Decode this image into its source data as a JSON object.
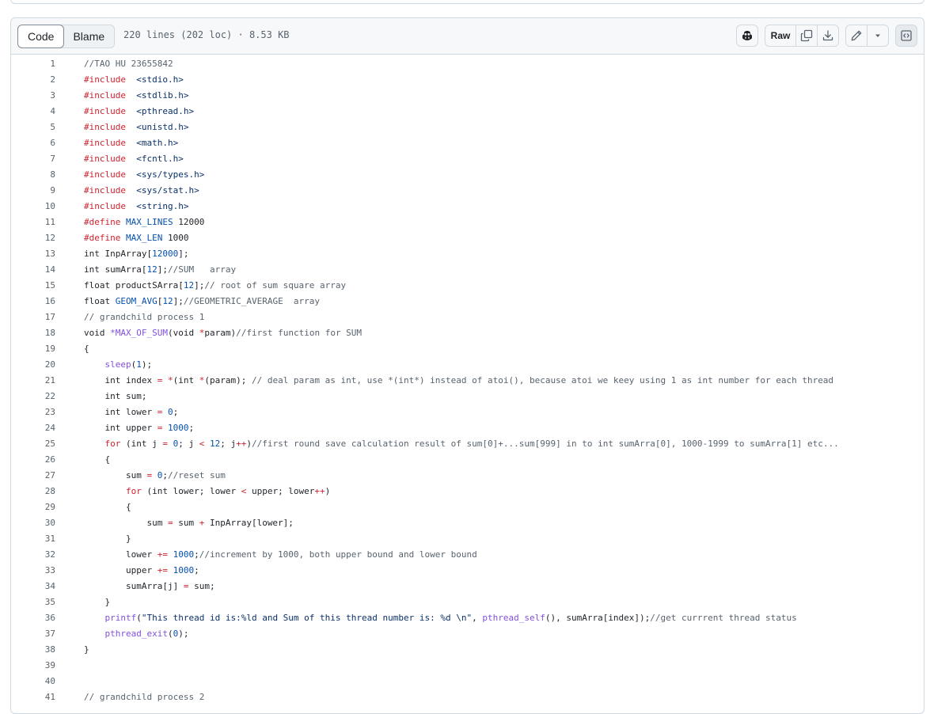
{
  "tabs": {
    "code": "Code",
    "blame": "Blame"
  },
  "file_info": "220 lines (202 loc) · 8.53 KB",
  "actions": {
    "copilot_icon": "copilot-icon",
    "raw": "Raw",
    "copy_icon": "copy-icon",
    "download_icon": "download-icon",
    "edit_icon": "pencil-icon",
    "more_icon": "triangle-down-icon",
    "symbols_icon": "code-square-icon"
  },
  "colors": {
    "comment": "#59636e",
    "keyword": "#cf222e",
    "number": "#0550ae",
    "function": "#8250df",
    "string": "#0a3069",
    "text": "#1f2328"
  },
  "lines": [
    {
      "n": "1",
      "t": [
        [
          "c",
          "//TAO HU 23655842"
        ]
      ]
    },
    {
      "n": "2",
      "t": [
        [
          "k",
          "#include"
        ],
        [
          "",
          "  "
        ],
        [
          "s",
          "<stdio.h>"
        ]
      ]
    },
    {
      "n": "3",
      "t": [
        [
          "k",
          "#include"
        ],
        [
          "",
          "  "
        ],
        [
          "s",
          "<stdlib.h>"
        ]
      ]
    },
    {
      "n": "4",
      "t": [
        [
          "k",
          "#include"
        ],
        [
          "",
          "  "
        ],
        [
          "s",
          "<pthread.h>"
        ]
      ]
    },
    {
      "n": "5",
      "t": [
        [
          "k",
          "#include"
        ],
        [
          "",
          "  "
        ],
        [
          "s",
          "<unistd.h>"
        ]
      ]
    },
    {
      "n": "6",
      "t": [
        [
          "k",
          "#include"
        ],
        [
          "",
          "  "
        ],
        [
          "s",
          "<math.h>"
        ]
      ]
    },
    {
      "n": "7",
      "t": [
        [
          "k",
          "#include"
        ],
        [
          "",
          "  "
        ],
        [
          "s",
          "<fcntl.h>"
        ]
      ]
    },
    {
      "n": "8",
      "t": [
        [
          "k",
          "#include"
        ],
        [
          "",
          "  "
        ],
        [
          "s",
          "<sys/types.h>"
        ]
      ]
    },
    {
      "n": "9",
      "t": [
        [
          "k",
          "#include"
        ],
        [
          "",
          "  "
        ],
        [
          "s",
          "<sys/stat.h>"
        ]
      ]
    },
    {
      "n": "10",
      "t": [
        [
          "k",
          "#include"
        ],
        [
          "",
          "  "
        ],
        [
          "s",
          "<string.h>"
        ]
      ]
    },
    {
      "n": "11",
      "t": [
        [
          "k",
          "#define"
        ],
        [
          "",
          " "
        ],
        [
          "n",
          "MAX_LINES"
        ],
        [
          "",
          " 12000"
        ]
      ]
    },
    {
      "n": "12",
      "t": [
        [
          "k",
          "#define"
        ],
        [
          "",
          " "
        ],
        [
          "n",
          "MAX_LEN"
        ],
        [
          "",
          " 1000"
        ]
      ]
    },
    {
      "n": "13",
      "t": [
        [
          "",
          "int InpArray["
        ],
        [
          "n",
          "12000"
        ],
        [
          "",
          "];"
        ]
      ]
    },
    {
      "n": "14",
      "t": [
        [
          "",
          "int sumArra["
        ],
        [
          "n",
          "12"
        ],
        [
          "",
          "];"
        ],
        [
          "c",
          "//SUM   array"
        ]
      ]
    },
    {
      "n": "15",
      "t": [
        [
          "",
          "float productSArra["
        ],
        [
          "n",
          "12"
        ],
        [
          "",
          "];"
        ],
        [
          "c",
          "// root of sum square array"
        ]
      ]
    },
    {
      "n": "16",
      "t": [
        [
          "",
          "float "
        ],
        [
          "n",
          "GEOM_AVG"
        ],
        [
          "",
          "["
        ],
        [
          "n",
          "12"
        ],
        [
          "",
          "];"
        ],
        [
          "c",
          "//GEOMETRIC_AVERAGE  array"
        ]
      ]
    },
    {
      "n": "17",
      "t": [
        [
          "c",
          "// grandchild process 1"
        ]
      ]
    },
    {
      "n": "18",
      "t": [
        [
          "",
          "void "
        ],
        [
          "f",
          "*MAX_OF_SUM"
        ],
        [
          "",
          "(void "
        ],
        [
          "k",
          "*"
        ],
        [
          "",
          "param)"
        ],
        [
          "c",
          "//first function for SUM"
        ]
      ]
    },
    {
      "n": "19",
      "t": [
        [
          "",
          "{"
        ]
      ]
    },
    {
      "n": "20",
      "t": [
        [
          "",
          "    "
        ],
        [
          "f",
          "sleep"
        ],
        [
          "",
          "("
        ],
        [
          "n",
          "1"
        ],
        [
          "",
          "); "
        ]
      ]
    },
    {
      "n": "21",
      "t": [
        [
          "",
          "    int index "
        ],
        [
          "k",
          "="
        ],
        [
          "",
          " "
        ],
        [
          "k",
          "*"
        ],
        [
          "",
          "(int "
        ],
        [
          "k",
          "*"
        ],
        [
          "",
          "(param); "
        ],
        [
          "c",
          "// deal param as int, use *(int*) instead of atoi(), because atoi we keey using 1 as int number for each thread"
        ]
      ]
    },
    {
      "n": "22",
      "t": [
        [
          "",
          "    int sum;"
        ]
      ]
    },
    {
      "n": "23",
      "t": [
        [
          "",
          "    int lower "
        ],
        [
          "k",
          "="
        ],
        [
          "",
          " "
        ],
        [
          "n",
          "0"
        ],
        [
          "",
          ";"
        ]
      ]
    },
    {
      "n": "24",
      "t": [
        [
          "",
          "    int upper "
        ],
        [
          "k",
          "="
        ],
        [
          "",
          " "
        ],
        [
          "n",
          "1000"
        ],
        [
          "",
          ";"
        ]
      ]
    },
    {
      "n": "25",
      "t": [
        [
          "",
          "    "
        ],
        [
          "k",
          "for"
        ],
        [
          "",
          " (int j "
        ],
        [
          "k",
          "="
        ],
        [
          "",
          " "
        ],
        [
          "n",
          "0"
        ],
        [
          "",
          "; j "
        ],
        [
          "k",
          "<"
        ],
        [
          "",
          " "
        ],
        [
          "n",
          "12"
        ],
        [
          "",
          "; j"
        ],
        [
          "k",
          "++"
        ],
        [
          "",
          ")"
        ],
        [
          "c",
          "//first round save calculation result of sum[0]+...sum[999] in to int sumArra[0], 1000-1999 to sumArra[1] etc..."
        ]
      ]
    },
    {
      "n": "26",
      "t": [
        [
          "",
          "    {"
        ]
      ]
    },
    {
      "n": "27",
      "t": [
        [
          "",
          "        sum "
        ],
        [
          "k",
          "="
        ],
        [
          "",
          " "
        ],
        [
          "n",
          "0"
        ],
        [
          "",
          ";"
        ],
        [
          "c",
          "//reset sum"
        ]
      ]
    },
    {
      "n": "28",
      "t": [
        [
          "",
          "        "
        ],
        [
          "k",
          "for"
        ],
        [
          "",
          " (int lower; lower "
        ],
        [
          "k",
          "<"
        ],
        [
          "",
          " upper; lower"
        ],
        [
          "k",
          "++"
        ],
        [
          "",
          ")"
        ]
      ]
    },
    {
      "n": "29",
      "t": [
        [
          "",
          "        {"
        ]
      ]
    },
    {
      "n": "30",
      "t": [
        [
          "",
          "            sum "
        ],
        [
          "k",
          "="
        ],
        [
          "",
          " sum "
        ],
        [
          "k",
          "+"
        ],
        [
          "",
          " InpArray[lower];"
        ]
      ]
    },
    {
      "n": "31",
      "t": [
        [
          "",
          "        }"
        ]
      ]
    },
    {
      "n": "32",
      "t": [
        [
          "",
          "        lower "
        ],
        [
          "k",
          "+="
        ],
        [
          "",
          " "
        ],
        [
          "n",
          "1000"
        ],
        [
          "",
          ";"
        ],
        [
          "c",
          "//increment by 1000, both upper bound and lower bound"
        ]
      ]
    },
    {
      "n": "33",
      "t": [
        [
          "",
          "        upper "
        ],
        [
          "k",
          "+="
        ],
        [
          "",
          " "
        ],
        [
          "n",
          "1000"
        ],
        [
          "",
          ";"
        ]
      ]
    },
    {
      "n": "34",
      "t": [
        [
          "",
          "        sumArra[j] "
        ],
        [
          "k",
          "="
        ],
        [
          "",
          " sum;"
        ]
      ]
    },
    {
      "n": "35",
      "t": [
        [
          "",
          "    }"
        ]
      ]
    },
    {
      "n": "36",
      "t": [
        [
          "",
          "    "
        ],
        [
          "f",
          "printf"
        ],
        [
          "",
          "("
        ],
        [
          "s",
          "\"This thread id is:%ld and Sum of this thread number is: %d \\n\""
        ],
        [
          "",
          ", "
        ],
        [
          "f",
          "pthread_self"
        ],
        [
          "",
          "(), sumArra[index]);"
        ],
        [
          "c",
          "//get currrent thread status"
        ]
      ]
    },
    {
      "n": "37",
      "t": [
        [
          "",
          "    "
        ],
        [
          "f",
          "pthread_exit"
        ],
        [
          "",
          "("
        ],
        [
          "n",
          "0"
        ],
        [
          "",
          "); "
        ]
      ]
    },
    {
      "n": "38",
      "t": [
        [
          "",
          "}"
        ]
      ]
    },
    {
      "n": "39",
      "t": []
    },
    {
      "n": "40",
      "t": []
    },
    {
      "n": "41",
      "t": [
        [
          "c",
          "// grandchild process 2"
        ]
      ]
    }
  ]
}
